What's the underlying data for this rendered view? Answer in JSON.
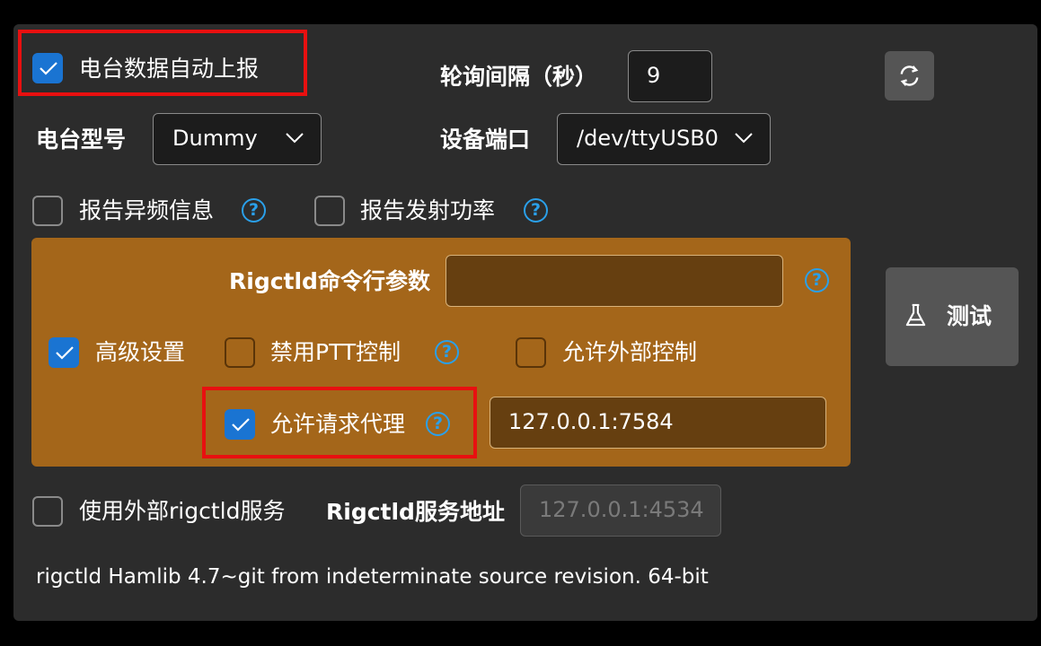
{
  "auto_report": {
    "label": "电台数据自动上报",
    "checked": true
  },
  "poll_interval": {
    "label": "轮询间隔（秒）",
    "value": "9"
  },
  "refresh_button": {
    "icon": "refresh-icon"
  },
  "radio_model": {
    "label": "电台型号",
    "selected": "Dummy"
  },
  "device_port": {
    "label": "设备端口",
    "selected": "/dev/ttyUSB0"
  },
  "report_freq_offset": {
    "label": "报告异频信息",
    "checked": false,
    "help": "?"
  },
  "report_tx_power": {
    "label": "报告发射功率",
    "checked": false,
    "help": "?"
  },
  "advanced": {
    "cmdline_label": "Rigctld命令行参数",
    "cmdline_value": "",
    "cmdline_help": "?",
    "advanced_settings": {
      "label": "高级设置",
      "checked": true
    },
    "disable_ptt": {
      "label": "禁用PTT控制",
      "checked": false,
      "help": "?"
    },
    "allow_external": {
      "label": "允许外部控制",
      "checked": false
    },
    "allow_proxy": {
      "label": "允许请求代理",
      "checked": true,
      "help": "?"
    },
    "proxy_address": "127.0.0.1:7584"
  },
  "test_button": {
    "label": "测试",
    "icon": "flask-icon"
  },
  "use_external_rigctld": {
    "label": "使用外部rigctld服务",
    "checked": false
  },
  "rigctld_address": {
    "label": "Rigctld服务地址",
    "placeholder": "127.0.0.1:4534"
  },
  "version_text": "rigctld Hamlib 4.7~git from indeterminate source revision. 64-bit",
  "colors": {
    "accent": "#1a74d2",
    "advanced_bg": "#a4661a",
    "help": "#2aa0ea",
    "highlight": "#e81010"
  }
}
